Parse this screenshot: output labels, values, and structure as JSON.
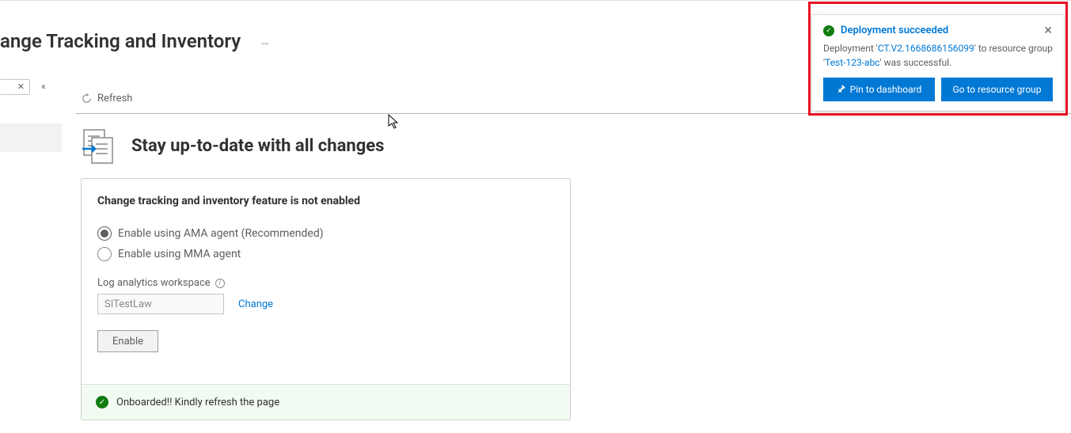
{
  "page": {
    "title_visible_fragment": "ange Tracking and Inventory",
    "ellipsis": "…"
  },
  "toolbar": {
    "refresh_label": "Refresh"
  },
  "header": {
    "heading": "Stay up-to-date with all changes"
  },
  "card": {
    "title": "Change tracking and inventory feature is not enabled",
    "radios": {
      "ama": "Enable using AMA agent (Recommended)",
      "mma": "Enable using MMA agent"
    },
    "workspace_label": "Log analytics workspace",
    "workspace_value": "SITestLaw",
    "change_link": "Change",
    "enable_button": "Enable",
    "status": "Onboarded!! Kindly refresh the page"
  },
  "toast": {
    "title": "Deployment succeeded",
    "body_prefix": "Deployment '",
    "deployment_name": "CT.V2.1668686156099",
    "body_mid": "' to resource group '",
    "resource_group": "Test-123-abc",
    "body_suffix": "' was successful.",
    "pin_button": "Pin to dashboard",
    "goto_button": "Go to resource group"
  }
}
